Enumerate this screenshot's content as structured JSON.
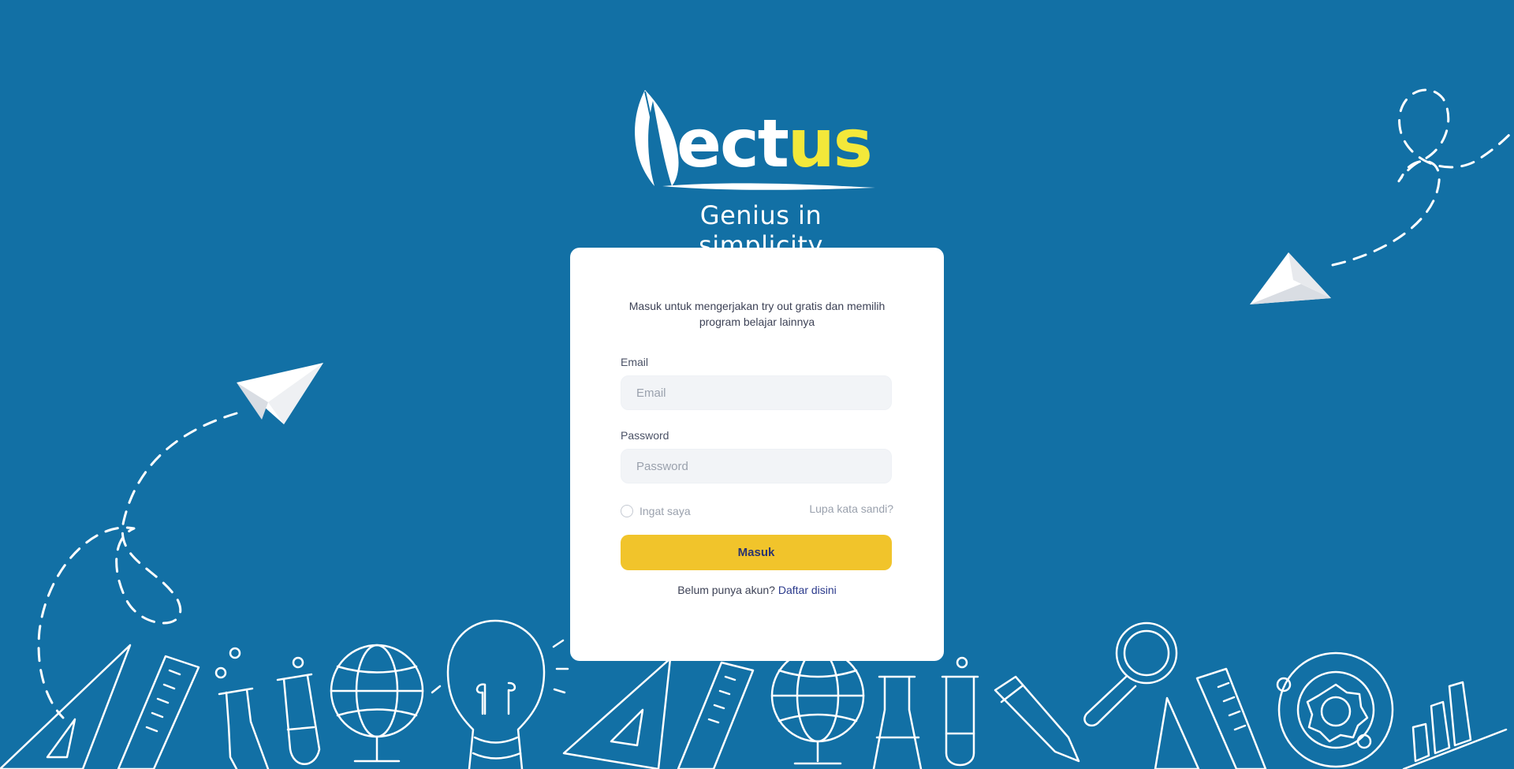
{
  "brand": {
    "logo_main": "ect",
    "logo_highlight": "us",
    "tagline": "Genius in simplicity",
    "colors": {
      "background": "#1270a5",
      "accent_yellow": "#f3e83a",
      "button": "#f1c42b"
    }
  },
  "login": {
    "intro": "Masuk untuk mengerjakan try out gratis dan memilih program belajar lainnya",
    "email_label": "Email",
    "email_placeholder": "Email",
    "email_value": "",
    "password_label": "Password",
    "password_placeholder": "Password",
    "password_value": "",
    "remember_label": "Ingat saya",
    "remember_checked": false,
    "forgot_label": "Lupa kata sandi?",
    "submit_label": "Masuk",
    "signup_prompt": "Belum punya akun?",
    "signup_link": "Daftar disini"
  },
  "decorations": {
    "icons": [
      "paper-plane-icon",
      "triangle-ruler-icon",
      "ruler-icon",
      "flask-icon",
      "test-tube-icon",
      "globe-icon",
      "light-bulb-icon",
      "magnifier-icon",
      "pencil-icon",
      "atom-icon",
      "bar-chart-icon"
    ]
  }
}
